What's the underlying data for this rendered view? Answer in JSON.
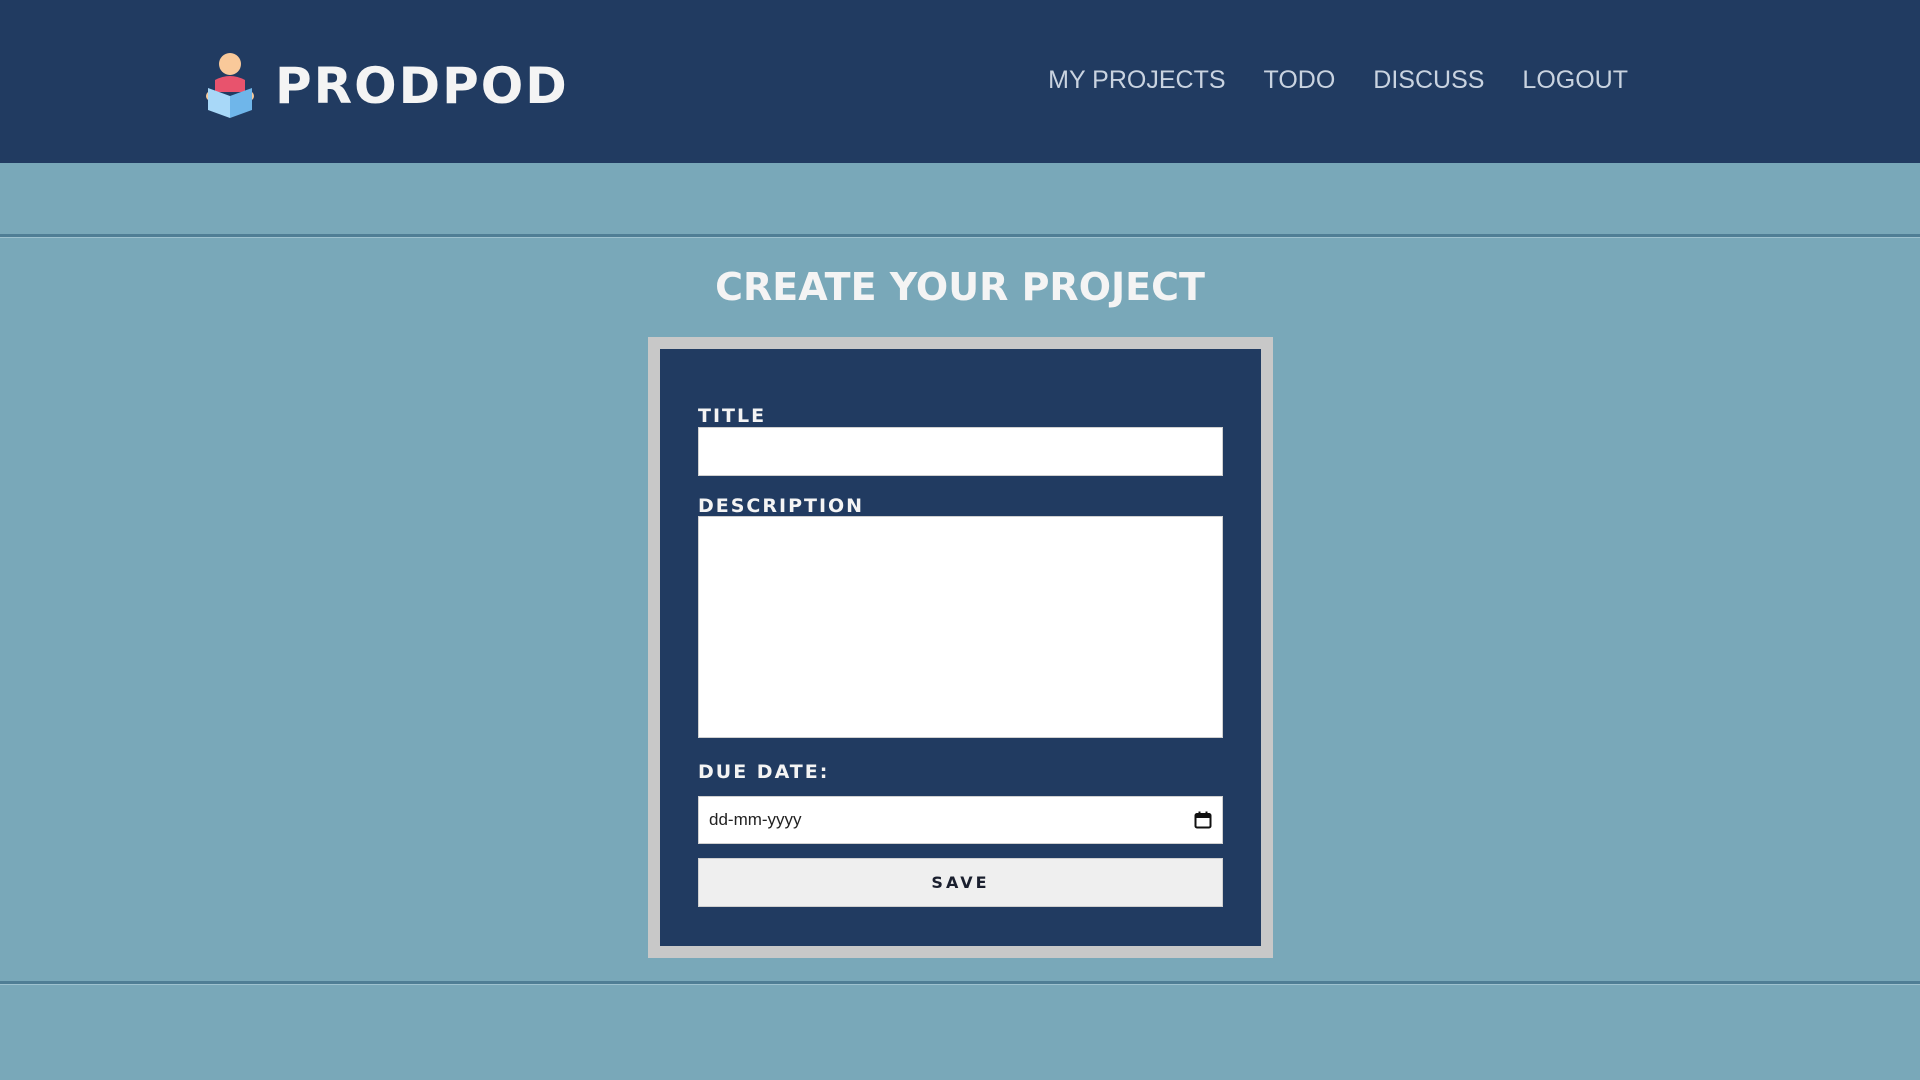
{
  "header": {
    "brand": "PRODPOD",
    "logo_icon": "reader-person-icon",
    "nav": [
      {
        "label": "MY PROJECTS"
      },
      {
        "label": "TODO"
      },
      {
        "label": "DISCUSS"
      },
      {
        "label": "LOGOUT"
      }
    ]
  },
  "page": {
    "title": "CREATE YOUR PROJECT"
  },
  "form": {
    "title_label": "TITLE",
    "title_value": "",
    "description_label": "DESCRIPTION",
    "description_value": "",
    "due_date_label": "DUE DATE:",
    "due_date_placeholder": "dd-mm-yyyy",
    "save_label": "SAVE"
  },
  "colors": {
    "navbar": "#213b61",
    "page_background": "#79a8b9",
    "form_card": "#213b61",
    "form_frame": "#c8c8c8"
  }
}
